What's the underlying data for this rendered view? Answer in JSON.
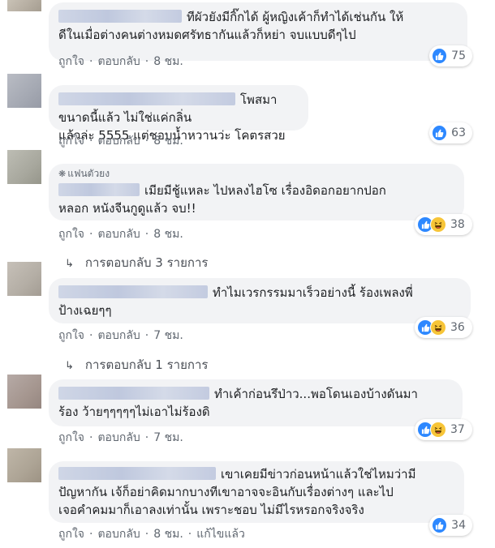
{
  "comments": [
    {
      "line1": "ทีผัวยังมีกิ๊กได้ ผู้หญิงเค้าก็ทำได้เช่นกัน ให้",
      "line2": "ดีในเมื่อต่างคนต่างหมดศรัทธากันแล้วก็หย่า จบแบบดีๆไป",
      "like": "ถูกใจ",
      "reply": "ตอบกลับ",
      "time": "8 ชม.",
      "reactions": "75",
      "reaction_types": [
        "like-icon"
      ]
    },
    {
      "line1": "โพสมาขนาดนี้แล้ว ไม่ใช่แค่กลิ่น",
      "line2": "แล้วล่ะ 5555 แต่ชอบน้ำหวานว่ะ โคตรสวย",
      "like": "ถูกใจ",
      "reply": "ตอบกลับ",
      "time": "8 ชม.",
      "reactions": "63",
      "reaction_types": [
        "like-icon"
      ]
    },
    {
      "badge": "แฟนตัวยง",
      "line1": "เมียมีชู้แหละ ไปหลงไฮโซ เรื่องอิดอกอยากปอก",
      "line2": "หลอก หนังจีนกูดูแล้ว จบ!!",
      "like": "ถูกใจ",
      "reply": "ตอบกลับ",
      "time": "8 ชม.",
      "reactions": "38",
      "reaction_types": [
        "like-icon",
        "haha-icon"
      ],
      "replies": "การตอบกลับ 3 รายการ"
    },
    {
      "line1": "ทำไมเวรกรรมมาเร็วอย่างนี้ ร้องเพลงพี่",
      "line2": "ป้างเฉยๆๆ",
      "like": "ถูกใจ",
      "reply": "ตอบกลับ",
      "time": "7 ชม.",
      "reactions": "36",
      "reaction_types": [
        "like-icon",
        "haha-icon"
      ],
      "replies": "การตอบกลับ 1 รายการ"
    },
    {
      "line1": "ทำเค้าก่อนรึป่าว...พอโดนเองบ้างดันมา",
      "line2": "ร้อง ว้ายๆๆๆๆๆไม่เอาไม่ร้องดิ",
      "like": "ถูกใจ",
      "reply": "ตอบกลับ",
      "time": "7 ชม.",
      "reactions": "37",
      "reaction_types": [
        "like-icon",
        "haha-icon"
      ]
    },
    {
      "line1": "เขาเคยมีข่าวก่อนหน้าแล้วใช่ไหมว่ามี",
      "line2": "ปัญหากัน เจ้ก็อย่าคิดมากบางทีเขาอาจจะอินกับเรื่องต่างๆ และไป",
      "line3": "เจอคำคมมาก็เอาลงเท่านั้น เพราะชอบ ไม่มีไรหรอกจริงจริง",
      "like": "ถูกใจ",
      "reply": "ตอบกลับ",
      "time": "8 ชม.",
      "edited": "แก้ไขแล้ว",
      "reactions": "34",
      "reaction_types": [
        "like-icon"
      ]
    }
  ],
  "colors": {
    "bubble": "#f2f3f5",
    "like": "#2d88ff",
    "haha": "#f7c538",
    "meta": "#606770"
  }
}
